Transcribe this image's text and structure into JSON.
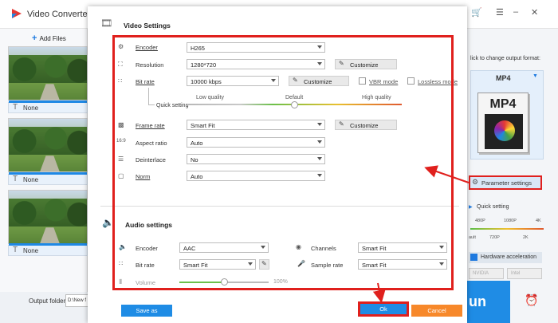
{
  "app": {
    "title": "Video Converter",
    "add_files_label": "Add Files",
    "tracks": [
      "None",
      "None",
      "None"
    ],
    "output_folder_label": "Output folder:",
    "output_folder_value": "D:\\New f",
    "right_panel": {
      "click_hint": "lick to change output format:",
      "format": "MP4",
      "format_icon_text": "MP4",
      "parameter_settings_label": "Parameter settings",
      "quick_setting_label": "Quick setting",
      "quality_top": [
        "480P",
        "1080P",
        "4K"
      ],
      "quality_bottom": [
        "ault",
        "720P",
        "2K"
      ],
      "hw_accel_label": "Hardware acceleration",
      "vendors": [
        "NVIDIA",
        "Intel"
      ],
      "run_label": "un"
    }
  },
  "dialog": {
    "title": "Video Settings",
    "video": {
      "encoder": {
        "label": "Encoder",
        "value": "H265"
      },
      "resolution": {
        "label": "Resolution",
        "value": "1280*720",
        "button": "Customize"
      },
      "bitrate": {
        "label": "Bit rate",
        "value": "10000 kbps",
        "button": "Customize",
        "vbr_label": "VBR mode",
        "lossless_label": "Lossless mode"
      },
      "quick_setting": {
        "label": "Quick setting",
        "low": "Low quality",
        "default": "Default",
        "high": "High quality",
        "position": 0.5
      },
      "framerate": {
        "label": "Frame rate",
        "value": "Smart Fit",
        "button": "Customize"
      },
      "aspect": {
        "label": "Aspect ratio",
        "value": "Auto"
      },
      "deinterlace": {
        "label": "Deinterlace",
        "value": "No"
      },
      "norm": {
        "label": "Norm",
        "value": "Auto"
      }
    },
    "audio": {
      "title": "Audio settings",
      "encoder": {
        "label": "Encoder",
        "value": "AAC"
      },
      "channels": {
        "label": "Channels",
        "value": "Smart Fit"
      },
      "bitrate": {
        "label": "Bit rate",
        "value": "Smart Fit"
      },
      "samplerate": {
        "label": "Sample rate",
        "value": "Smart Fit"
      },
      "volume": {
        "label": "Volume",
        "value": "100%",
        "level": 0.5
      }
    },
    "footer": {
      "save_as": "Save as",
      "ok": "Ok",
      "cancel": "Cancel"
    }
  },
  "colors": {
    "accent": "#1f8ce5",
    "highlight": "#e0201d",
    "cancel": "#f7882a"
  }
}
